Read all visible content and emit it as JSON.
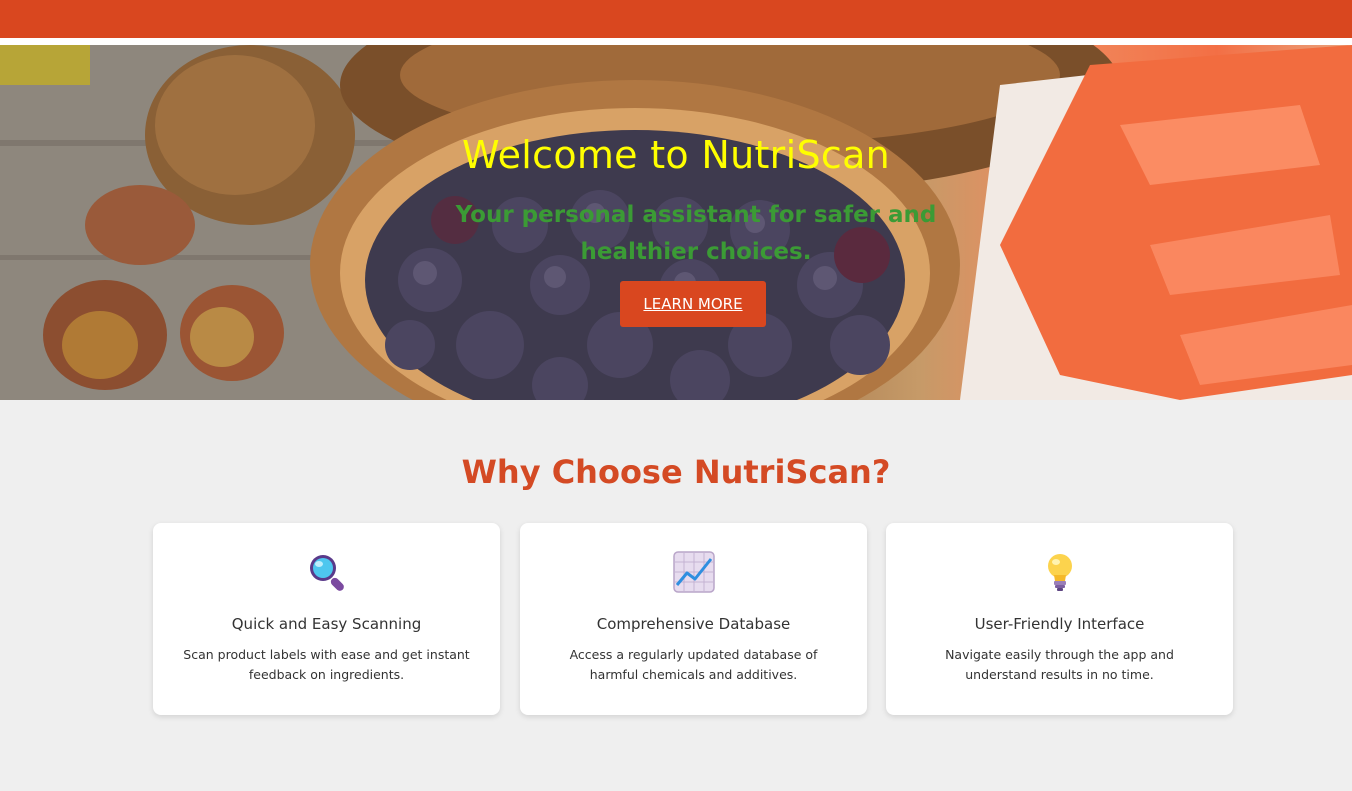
{
  "hero": {
    "title": "Welcome to NutriScan",
    "subtitle": "Your personal assistant for safer and healthier choices.",
    "button_label": "LEARN MORE"
  },
  "features": {
    "title": "Why Choose NutriScan?",
    "cards": [
      {
        "icon": "magnifying-glass-icon",
        "title": "Quick and Easy Scanning",
        "description": "Scan product labels with ease and get instant feedback on ingredients."
      },
      {
        "icon": "chart-increasing-icon",
        "title": "Comprehensive Database",
        "description": "Access a regularly updated database of harmful chemicals and additives."
      },
      {
        "icon": "light-bulb-icon",
        "title": "User-Friendly Interface",
        "description": "Navigate easily through the app and understand results in no time."
      }
    ]
  },
  "colors": {
    "brand": "#d9471f",
    "hero_title": "#ffff00",
    "hero_subtitle": "#3b9b35",
    "background": "#efefef"
  }
}
